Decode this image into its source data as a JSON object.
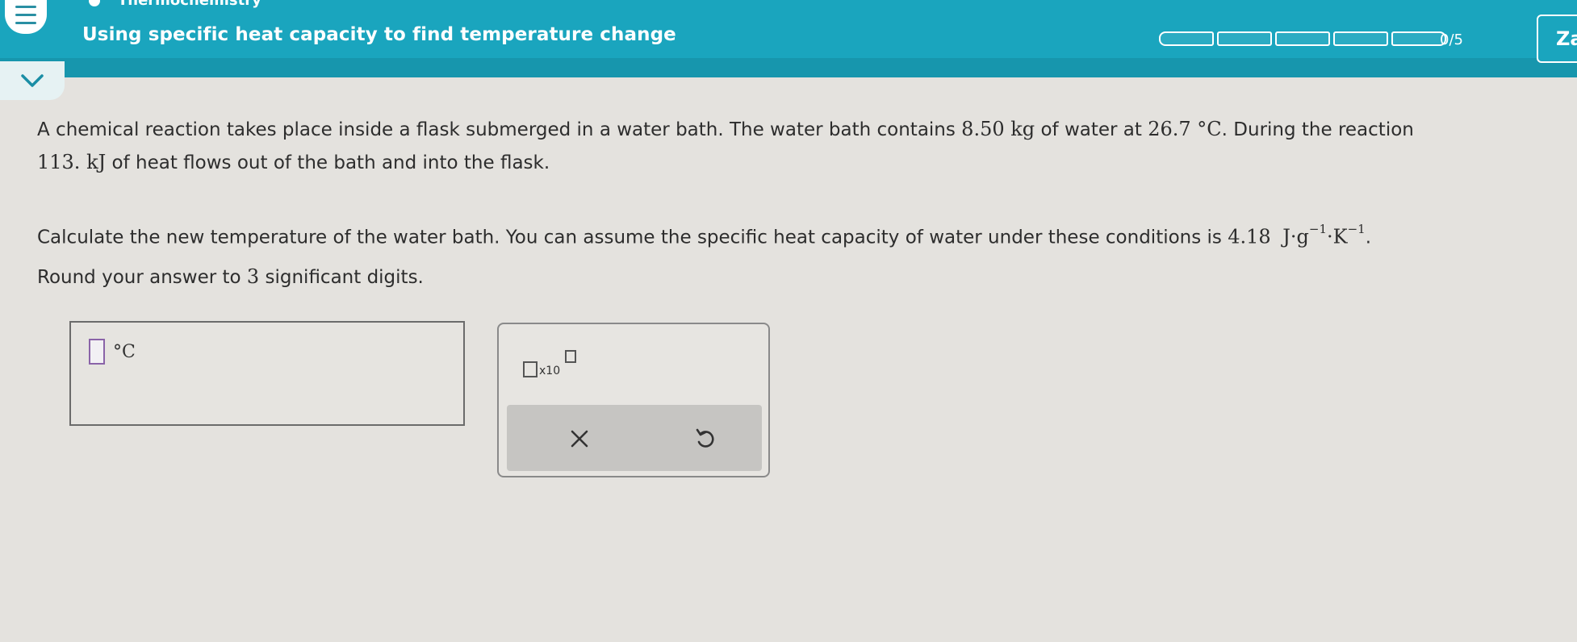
{
  "header": {
    "subject": "Thermochemistry",
    "title": "Using specific heat capacity to find temperature change",
    "progress": {
      "completed": 0,
      "total": 5,
      "text": "0/5"
    },
    "user_initials": "Za"
  },
  "question": {
    "p1_a": "A chemical reaction takes place inside a flask submerged in a water bath. The water bath contains ",
    "mass": "8.50 kg",
    "p1_b": " of water at ",
    "temp": "26.7 °C",
    "p1_c": ". During the reaction ",
    "heat": "113. kJ",
    "p1_d": " of heat flows out of the bath and into the flask.",
    "p2_a": "Calculate the new temperature of the water bath. You can assume the specific heat capacity of water under these conditions is ",
    "cap_value": "4.18",
    "cap_j": "J·g",
    "cap_exp1": "−1",
    "cap_k": "·K",
    "cap_exp2": "−1",
    "p2_b": ".",
    "p2_c": "Round your answer to ",
    "sig": "3",
    "p2_d": " significant digits."
  },
  "answer": {
    "value": "",
    "unit": "°C"
  },
  "tools": {
    "sci_label": "x10",
    "clear_icon": "close-icon",
    "undo_icon": "undo-icon"
  },
  "colors": {
    "header": "#1aa5be",
    "input_border": "#8a63a8",
    "background": "#e4e2de"
  }
}
